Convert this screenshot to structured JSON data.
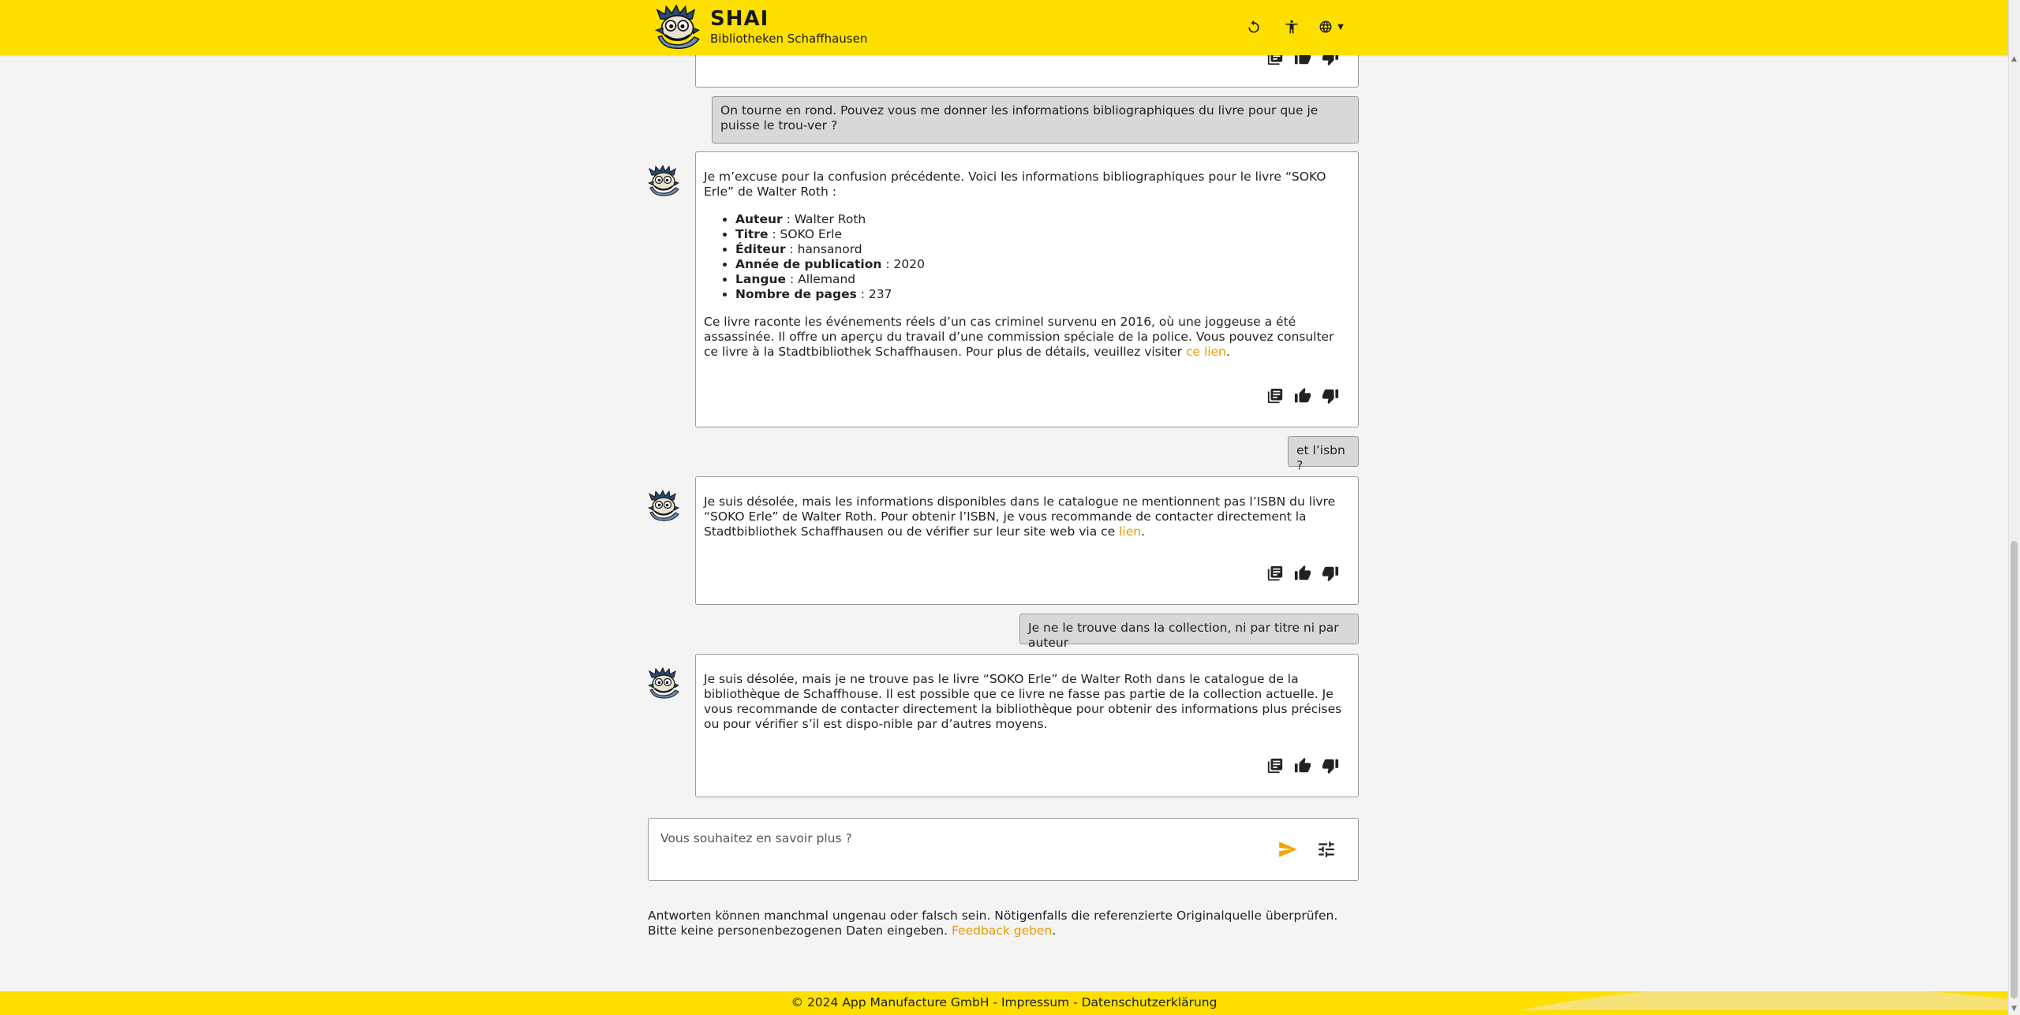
{
  "header": {
    "app_name": "SHAI",
    "subtitle": "Bibliotheken Schaffhausen",
    "icons": [
      "reset-icon",
      "accessibility-icon",
      "globe-icon"
    ]
  },
  "messages": {
    "partial_bot_actions": [
      "sources-icon",
      "thumbs-up-icon",
      "thumbs-down-icon"
    ],
    "user1": "On tourne en rond. Pouvez vous me donner les informations bibliographiques du livre pour que je puisse le trou-ver ?",
    "bot1": {
      "intro": "Je m’excuse pour la confusion précédente. Voici les informations bibliographiques pour le livre “SOKO Erle” de Walter Roth :",
      "items": [
        {
          "label": "Auteur",
          "value": " : Walter Roth"
        },
        {
          "label": "Titre",
          "value": " : SOKO Erle"
        },
        {
          "label": "Éditeur",
          "value": " : hansanord"
        },
        {
          "label": "Année de publication",
          "value": " : 2020"
        },
        {
          "label": "Langue",
          "value": " : Allemand"
        },
        {
          "label": "Nombre de pages",
          "value": " : 237"
        }
      ],
      "outro": "Ce livre raconte les événements réels d’un cas criminel survenu en 2016, où une joggeuse a été assassinée. Il offre un aperçu du travail d’une commission spéciale de la police. Vous pouvez consulter ce livre à la Stadtbibliothek Schaffhausen. Pour plus de détails, veuillez visiter ",
      "link": "ce lien",
      "end": "."
    },
    "user2": "et l’isbn ?",
    "bot2": {
      "text": "Je suis désolée, mais les informations disponibles dans le catalogue ne mentionnent pas l’ISBN du livre “SOKO Erle” de Walter Roth. Pour obtenir l’ISBN, je vous recommande de contacter directement la Stadtbibliothek Schaffhausen ou de vérifier sur leur site web via ce ",
      "link": "lien",
      "end": "."
    },
    "user3": "Je ne le trouve dans la collection, ni par titre ni par auteur",
    "bot3": {
      "text": "Je suis désolée, mais je ne trouve pas le livre “SOKO Erle” de Walter Roth dans le catalogue de la bibliothèque de Schaffhouse. Il est possible que ce livre ne fasse pas partie de la collection actuelle. Je vous recommande de contacter directement la bibliothèque pour obtenir des informations plus précises ou pour vérifier s’il est dispo-nible par d’autres moyens."
    }
  },
  "input": {
    "placeholder": "Vous souhaitez en savoir plus ?"
  },
  "disclaimer": {
    "text": "Antworten können manchmal ungenau oder falsch sein. Nötigenfalls die referenzierte Originalquelle überprüfen. Bitte keine personenbezogenen Daten eingeben. ",
    "link": "Feedback geben",
    "end": "."
  },
  "footer": {
    "copyright": "© 2024 App Manufacture GmbH",
    "sep1": " - ",
    "impressum": "Impressum",
    "sep2": " - ",
    "privacy": "Datenschutzerklärung"
  },
  "colors": {
    "brand_yellow": "#fde000",
    "link_orange": "#e99a00",
    "user_bubble": "#d8d8d8"
  }
}
